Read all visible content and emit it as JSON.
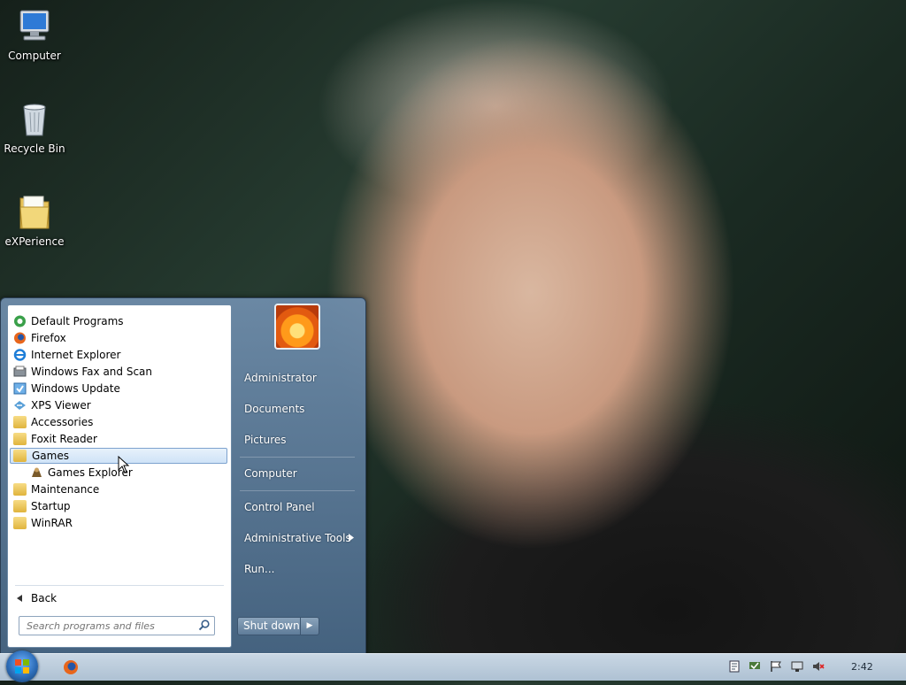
{
  "desktop": {
    "icons": [
      {
        "label": "Computer",
        "icon": "computer-icon"
      },
      {
        "label": "Recycle Bin",
        "icon": "recycle-bin-icon"
      },
      {
        "label": "eXPerience",
        "icon": "folder-icon"
      }
    ]
  },
  "start_menu": {
    "programs": [
      {
        "label": "Default Programs",
        "icon": "default-programs-icon"
      },
      {
        "label": "Firefox",
        "icon": "firefox-icon"
      },
      {
        "label": "Internet Explorer",
        "icon": "internet-explorer-icon"
      },
      {
        "label": "Windows Fax and Scan",
        "icon": "fax-scan-icon"
      },
      {
        "label": "Windows Update",
        "icon": "windows-update-icon"
      },
      {
        "label": "XPS Viewer",
        "icon": "xps-viewer-icon"
      },
      {
        "label": "Accessories",
        "icon": "folder-icon"
      },
      {
        "label": "Foxit Reader",
        "icon": "folder-icon"
      },
      {
        "label": "Games",
        "icon": "folder-icon",
        "selected": true
      },
      {
        "label": "Games Explorer",
        "icon": "games-explorer-icon"
      },
      {
        "label": "Maintenance",
        "icon": "folder-icon"
      },
      {
        "label": "Startup",
        "icon": "folder-icon"
      },
      {
        "label": "WinRAR",
        "icon": "folder-icon"
      }
    ],
    "back_label": "Back",
    "search_placeholder": "Search programs and files",
    "right_items": [
      {
        "label": "Administrator"
      },
      {
        "label": "Documents"
      },
      {
        "label": "Pictures"
      },
      {
        "label": "Computer"
      },
      {
        "label": "Control Panel"
      },
      {
        "label": "Administrative Tools",
        "has_submenu": true
      },
      {
        "label": "Run..."
      }
    ],
    "shutdown_label": "Shut down"
  },
  "taskbar": {
    "clock": "2:42",
    "pinned": [
      {
        "icon": "firefox-icon"
      }
    ],
    "tray_icons": [
      "document-icon",
      "network-check-icon",
      "flag-icon",
      "monitor-icon",
      "volume-muted-icon"
    ]
  },
  "colors": {
    "selection": "#cfe3f7",
    "start_menu_glass": "#5f7c99",
    "taskbar": "#aec1d3"
  }
}
